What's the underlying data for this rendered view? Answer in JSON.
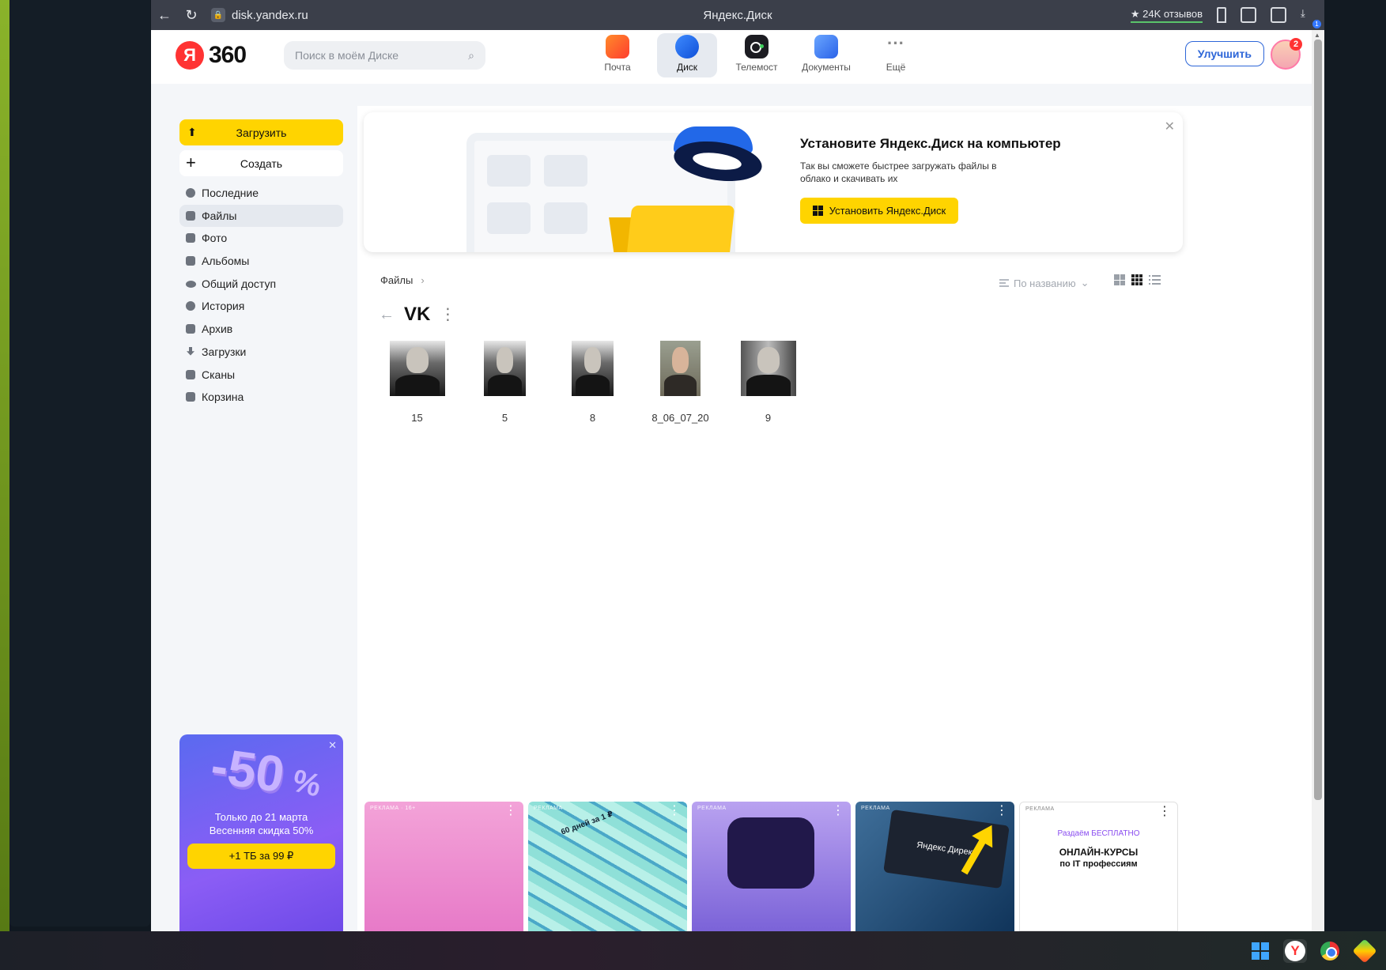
{
  "browser": {
    "url": "disk.yandex.ru",
    "tab_title": "Яндекс.Диск",
    "reviews": "24K отзывов",
    "downloads_badge": "1"
  },
  "header": {
    "logo_letter": "Я",
    "logo_text": "360",
    "search_placeholder": "Поиск в моём Диске",
    "services": [
      {
        "label": "Почта",
        "icon": "mail-icon"
      },
      {
        "label": "Диск",
        "icon": "disk-icon",
        "active": true
      },
      {
        "label": "Телемост",
        "icon": "telemost-icon"
      },
      {
        "label": "Документы",
        "icon": "docs-icon"
      },
      {
        "label": "Ещё",
        "icon": "more-icon",
        "symbol": "···"
      }
    ],
    "upgrade_label": "Улучшить",
    "avatar_badge": "2"
  },
  "sidebar": {
    "upload_label": "Загрузить",
    "create_label": "Создать",
    "items": [
      {
        "label": "Последние",
        "icon": "clock-icon"
      },
      {
        "label": "Файлы",
        "icon": "file-icon",
        "active": true
      },
      {
        "label": "Фото",
        "icon": "photo-icon"
      },
      {
        "label": "Альбомы",
        "icon": "album-icon"
      },
      {
        "label": "Общий доступ",
        "icon": "people-icon"
      },
      {
        "label": "История",
        "icon": "history-icon"
      },
      {
        "label": "Архив",
        "icon": "archive-icon"
      },
      {
        "label": "Загрузки",
        "icon": "download-icon"
      },
      {
        "label": "Сканы",
        "icon": "scan-icon"
      },
      {
        "label": "Корзина",
        "icon": "trash-icon"
      }
    ],
    "promo": {
      "big": "-50",
      "percent": "%",
      "text_line1": "Только до 21 марта",
      "text_line2": "Весенняя скидка 50%",
      "button": "+1 ТБ за 99 ₽"
    }
  },
  "banner": {
    "title": "Установите Яндекс.Диск на компьютер",
    "subtitle": "Так вы сможете быстрее загружать файлы в облако и скачивать их",
    "button": "Установить Яндекс.Диск"
  },
  "content": {
    "breadcrumb": "Файлы",
    "sort_label": "По названию",
    "folder_title": "VK",
    "files": [
      {
        "name": "15",
        "style": "bw"
      },
      {
        "name": "5",
        "style": "bw"
      },
      {
        "name": "8",
        "style": "bw"
      },
      {
        "name": "8_06_07_20",
        "style": "color"
      },
      {
        "name": "9",
        "style": "grey"
      }
    ]
  },
  "ads": [
    {
      "label": "РЕКЛАМА · 16+"
    },
    {
      "label": "РЕКЛАМА",
      "text": "60 дней за 1 ₽"
    },
    {
      "label": "РЕКЛАМА"
    },
    {
      "label": "РЕКЛАМА",
      "text": "Яндекс Директ"
    },
    {
      "label": "РЕКЛАМА",
      "line1": "Раздаём БЕСПЛАТНО",
      "line2": "ОНЛАЙН-КУРСЫ",
      "line3": "по IT профессиям"
    }
  ]
}
